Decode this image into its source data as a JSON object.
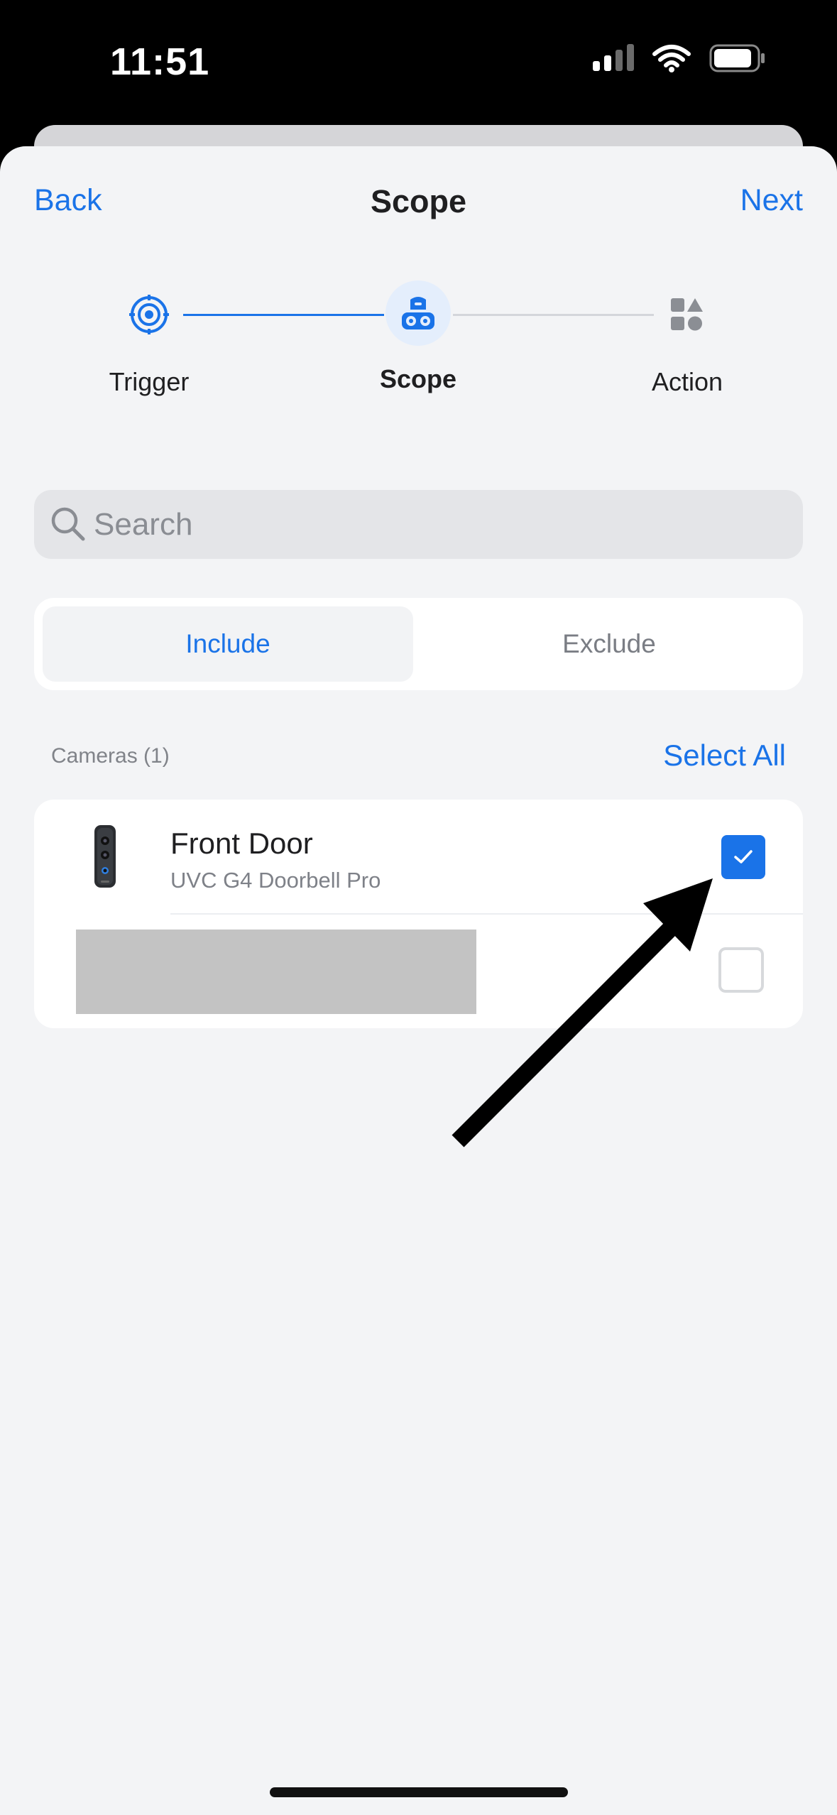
{
  "status_bar": {
    "time": "11:51"
  },
  "nav": {
    "back_label": "Back",
    "title": "Scope",
    "next_label": "Next"
  },
  "stepper": {
    "steps": [
      {
        "label": "Trigger",
        "icon": "target-icon",
        "state": "done"
      },
      {
        "label": "Scope",
        "icon": "camera-group-icon",
        "state": "active"
      },
      {
        "label": "Action",
        "icon": "shapes-icon",
        "state": "pending"
      }
    ]
  },
  "search": {
    "placeholder": "Search",
    "value": ""
  },
  "segment": {
    "include_label": "Include",
    "exclude_label": "Exclude",
    "selected": "Include"
  },
  "section": {
    "label": "Cameras (1)",
    "select_all_label": "Select All"
  },
  "devices": [
    {
      "name": "Front Door",
      "model": "UVC G4 Doorbell Pro",
      "checked": true
    },
    {
      "name": "",
      "model": "",
      "checked": false
    }
  ],
  "colors": {
    "accent": "#1a73e8",
    "background": "#f3f4f6",
    "card": "#ffffff"
  }
}
